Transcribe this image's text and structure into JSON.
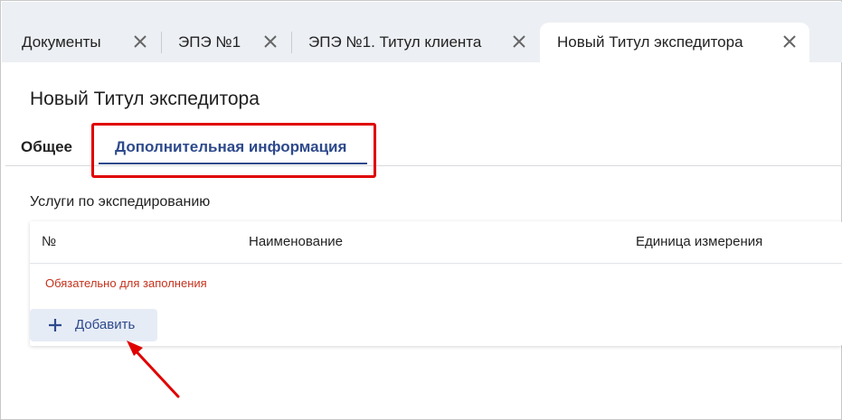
{
  "window_tabs": [
    {
      "label": "Документы",
      "active": false
    },
    {
      "label": "ЭПЭ №1",
      "active": false
    },
    {
      "label": "ЭПЭ №1. Титул клиента",
      "active": false
    },
    {
      "label": "Новый Титул экспедитора",
      "active": true
    }
  ],
  "page": {
    "title": "Новый Титул экспедитора"
  },
  "sub_tabs": [
    {
      "label": "Общее",
      "active": false
    },
    {
      "label": "Дополнительная информация",
      "active": true
    }
  ],
  "section": {
    "title": "Услуги по экспедированию",
    "columns": [
      "№",
      "Наименование",
      "Единица измерения"
    ],
    "required_message": "Обязательно для заполнения",
    "add_button_label": "Добавить"
  },
  "icons": {
    "close": "close-icon",
    "add": "plus-icon"
  },
  "colors": {
    "accent": "#2e4a8c",
    "highlight": "#e00000",
    "error": "#c4321c",
    "tabstrip_bg": "#eceff3",
    "button_bg": "#e6ecf6"
  }
}
